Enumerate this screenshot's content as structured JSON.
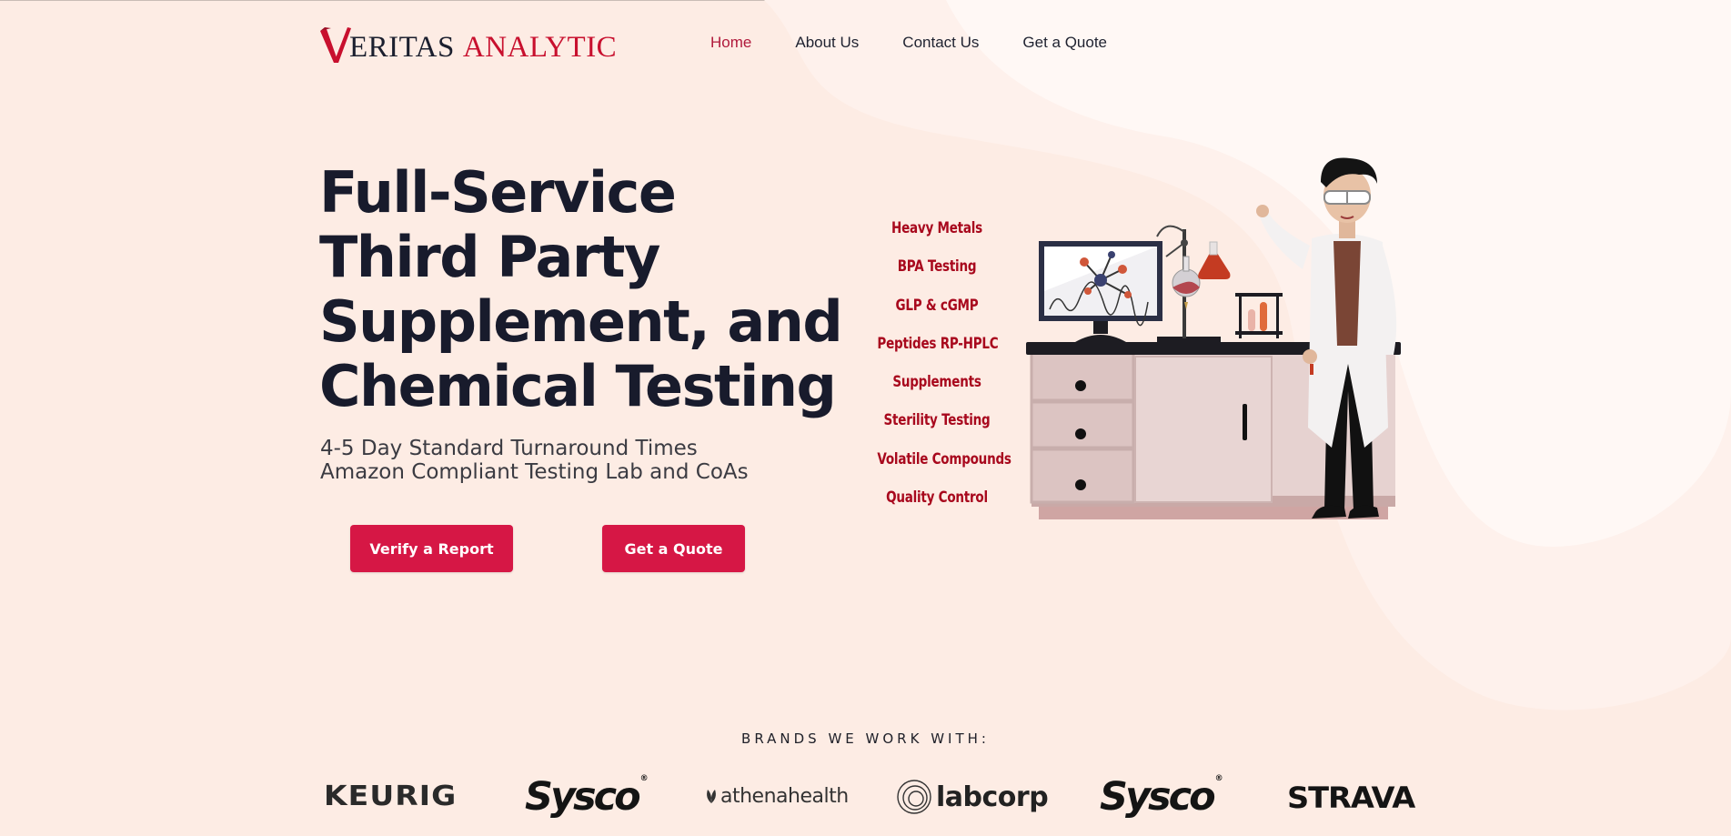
{
  "logo": {
    "word1": "ERITAS",
    "word2": "ANALYTIC"
  },
  "nav": {
    "items": [
      {
        "label": "Home",
        "active": true
      },
      {
        "label": "About Us"
      },
      {
        "label": "Contact Us"
      },
      {
        "label": "Get a Quote"
      }
    ]
  },
  "hero": {
    "title_lines": [
      "Full-Service",
      "Third Party",
      "Supplement, and",
      "Chemical Testing"
    ],
    "subtitle_lines": [
      "4-5 Day Standard Turnaround Times",
      "Amazon Compliant Testing Lab and CoAs"
    ],
    "verify_button": "Verify a Report",
    "quote_button": "Get a Quote"
  },
  "tests": [
    "Heavy Metals",
    "BPA Testing",
    "GLP & cGMP",
    "Peptides RP-HPLC",
    "Supplements",
    "Sterility Testing",
    "Volatile Compounds",
    "Quality Control"
  ],
  "brands": {
    "title": "BRANDS WE WORK WITH:",
    "logos": [
      "KEURIG",
      "Sysco",
      "athenahealth",
      "labcorp",
      "Sysco",
      "STRAVA"
    ]
  },
  "colors": {
    "background": "#fdece4",
    "accent": "#d61745",
    "brand_red": "#c8102e",
    "text_dark": "#181b2c"
  }
}
